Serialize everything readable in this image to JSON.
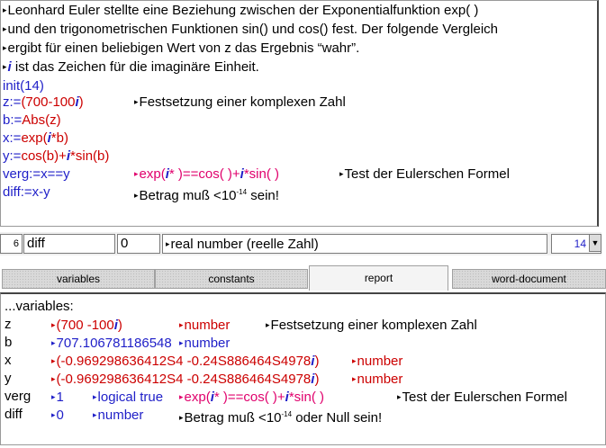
{
  "editor": {
    "intro": [
      "Leonhard Euler stellte eine Beziehung zwischen der Exponentialfunktion exp( )",
      "und den trigonometrischen Funktionen sin() und cos() fest. Der folgende Vergleich",
      "ergibt  für einen beliebigen Wert von z das Ergebnis “wahr”.",
      "ist das Zeichen für die imaginäre Einheit."
    ],
    "i_symbol": "i",
    "init": "init(14)",
    "z_def": {
      "lhs": "z:=",
      "value": "(700-100",
      "close": ")",
      "comment": "Festsetzung einer  komplexen Zahl"
    },
    "b_def": {
      "lhs": "b:=",
      "expr": "Abs(z)"
    },
    "x_def": {
      "lhs": "x:=",
      "open": "exp(",
      "mid": "*b",
      "close": ")"
    },
    "y_def": {
      "lhs": "y:=",
      "open": "cos(b)+",
      "mid": "*sin(b)"
    },
    "verg_def": {
      "lhs": "verg:=x==y",
      "f1": "exp(",
      "f2": "* )==cos( )+",
      "f3": "*sin( )",
      "comment": "Test der Eulerschen Formel"
    },
    "diff_def": {
      "lhs": "diff:=x-y",
      "comment_pre": "Betrag muß <10",
      "exp": "-14",
      "comment_post": " sein!"
    }
  },
  "input_bar": {
    "line_number": "6",
    "name_field": "diff",
    "value_field": "0",
    "type_field": "real number (reelle Zahl)",
    "precision": "14",
    "dropdown_icon": "chevron-down-icon"
  },
  "tabs": [
    {
      "label": "variables",
      "active": false
    },
    {
      "label": "constants",
      "active": false
    },
    {
      "label": "report",
      "active": true
    },
    {
      "label": "word-document",
      "active": false
    }
  ],
  "report": {
    "header": "...variables:",
    "rows": {
      "z": {
        "name": "z",
        "value_pre": "(700  -100",
        "value_post": ")",
        "type": "number",
        "comment": "Festsetzung einer  komplexen Zahl"
      },
      "b": {
        "name": "b",
        "value": "707.106781186548",
        "type": "number"
      },
      "x": {
        "name": "x",
        "value_pre": "(-0.969298636412S4  -0.24S886464S4978",
        "value_post": ")",
        "type": "number"
      },
      "y": {
        "name": "y",
        "value_pre": "(-0.969298636412S4  -0.24S886464S4978",
        "value_post": ")",
        "type": "number"
      },
      "verg": {
        "name": "verg",
        "value": "1",
        "type": "logical true",
        "f1": "exp(",
        "f2": "* )==cos( )+",
        "f3": "*sin( )",
        "comment": "Test der Eulerschen Formel"
      },
      "diff": {
        "name": "diff",
        "value": "0",
        "type": "number",
        "comment_pre": "Betrag muß <10",
        "exp": "-14",
        "comment_post": "  oder Null sein!"
      }
    }
  },
  "colors": {
    "blue": "#1f1fc8",
    "red": "#cc0000",
    "magenta": "#e0006c"
  }
}
